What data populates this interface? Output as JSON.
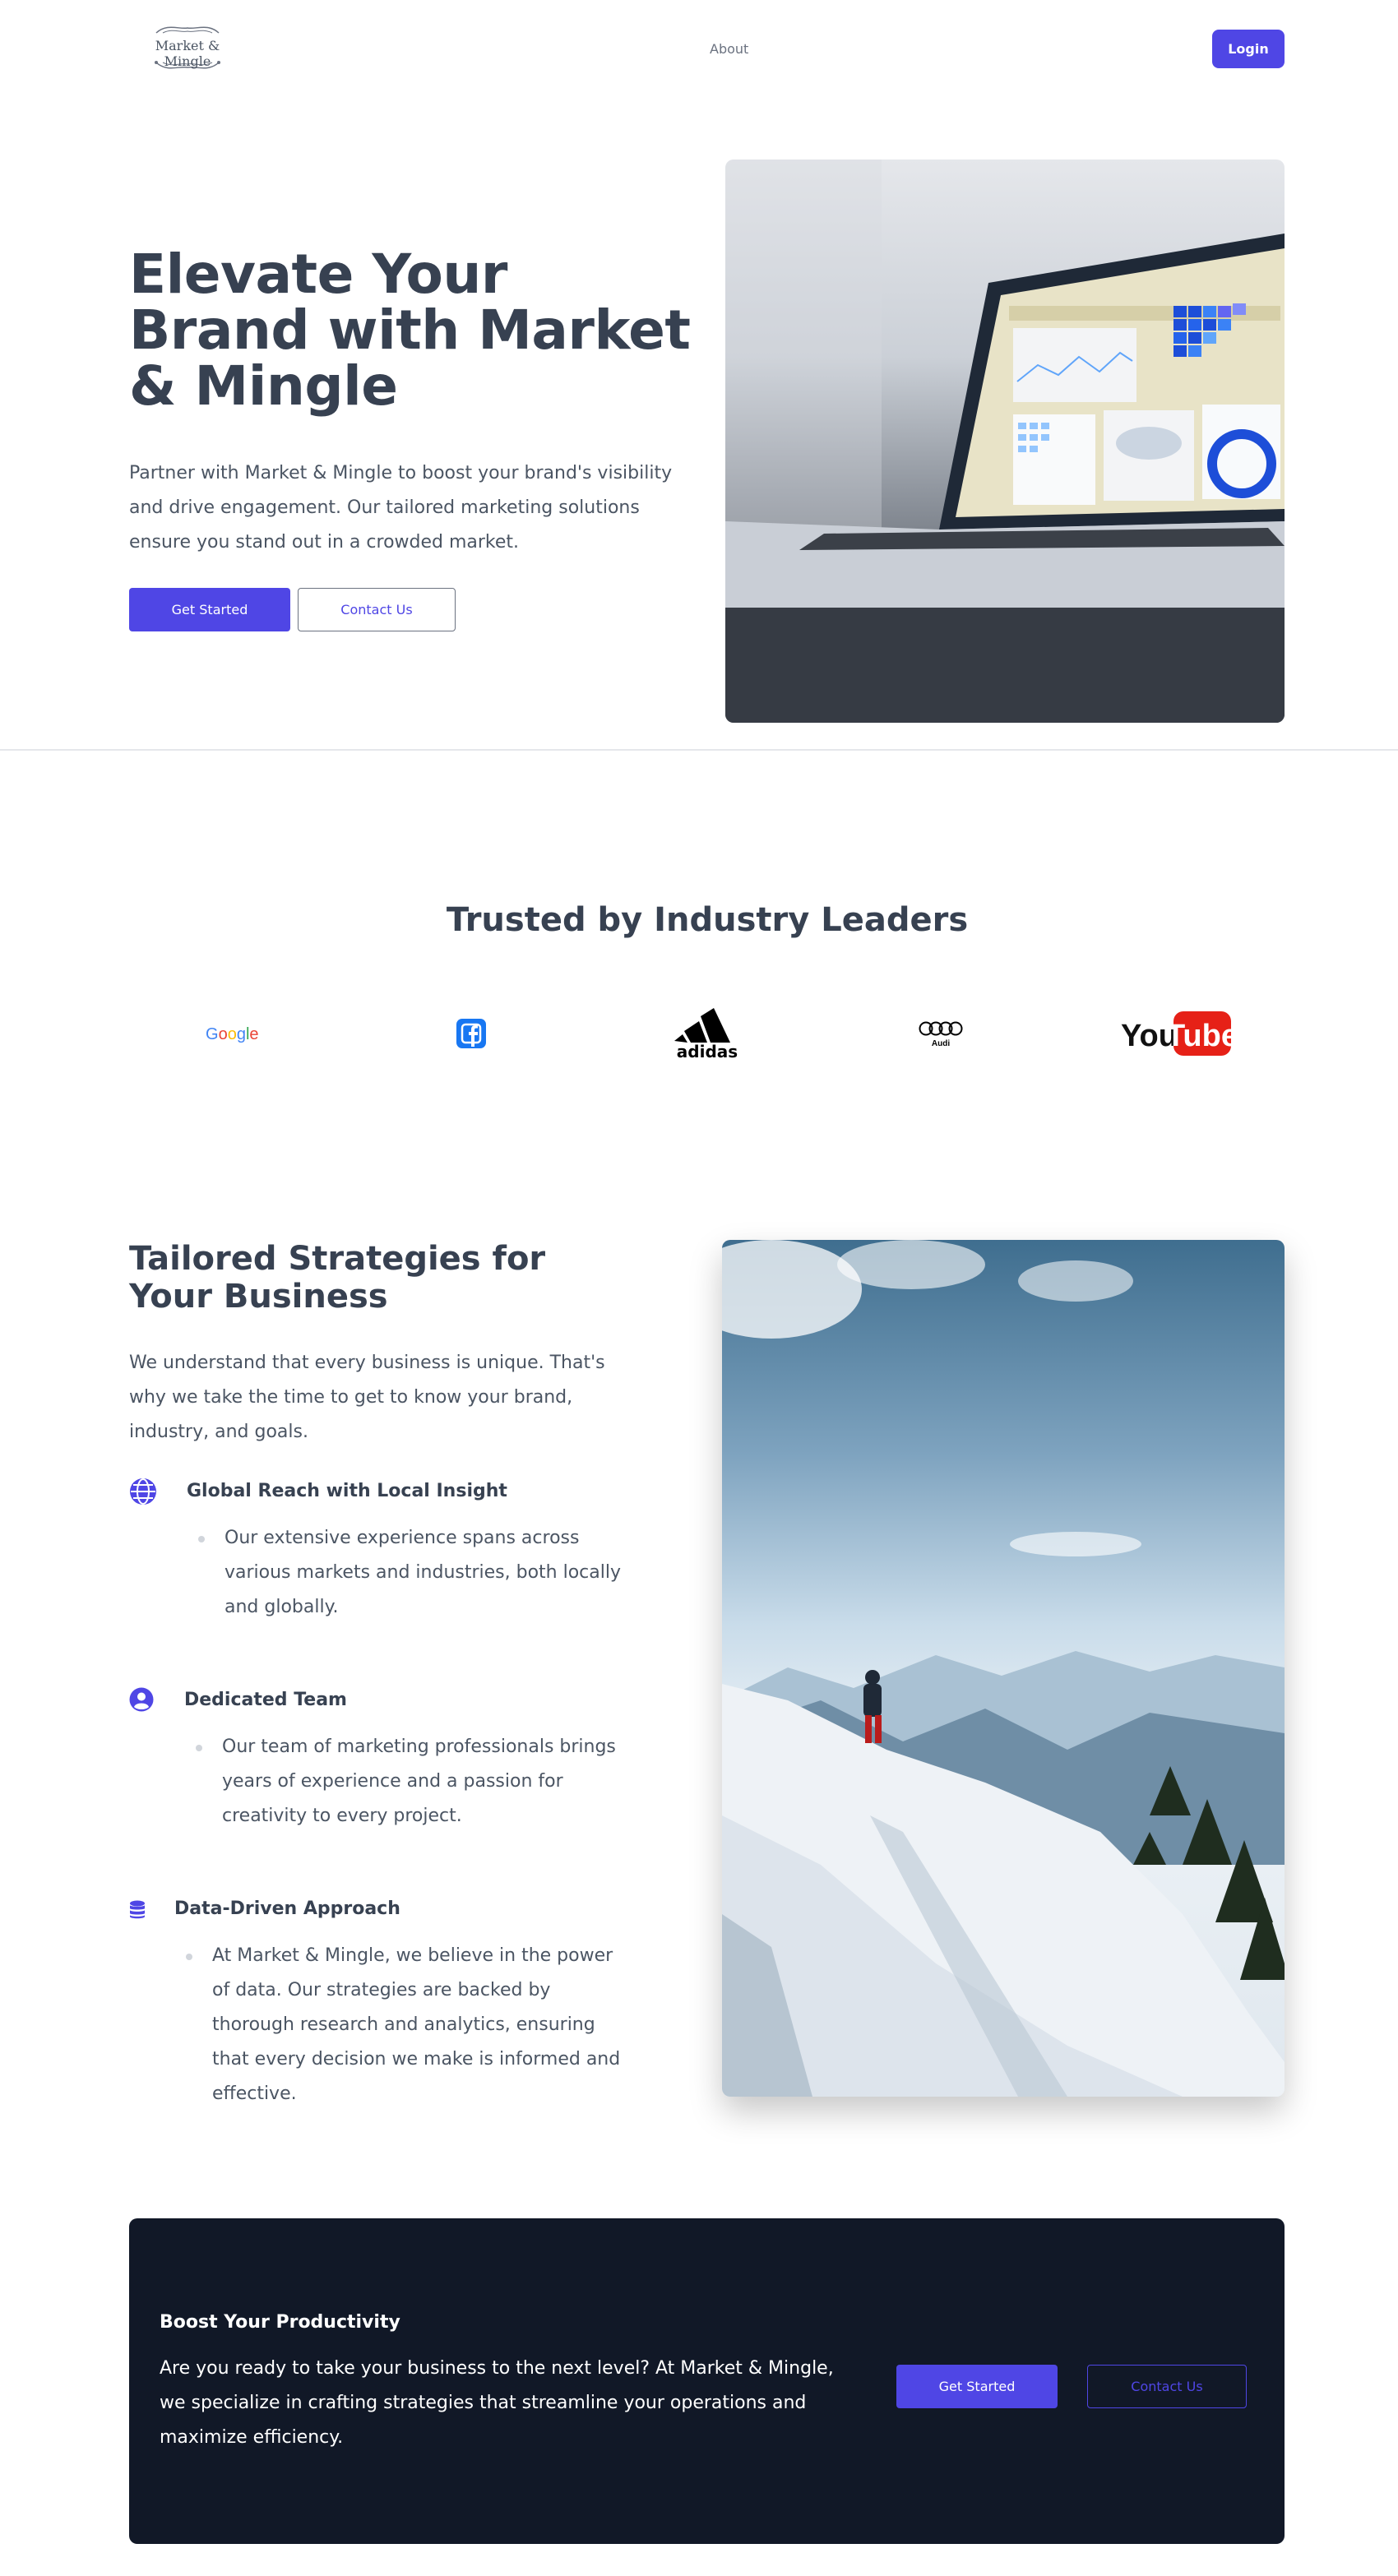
{
  "header": {
    "logo_text": "Market & Mingle",
    "nav_about": "About",
    "login_label": "Login"
  },
  "hero": {
    "title": "Elevate Your Brand with Market & Mingle",
    "description": "Partner with Market & Mingle to boost your brand's visibility and drive engagement. Our tailored marketing solutions ensure you stand out in a crowded market.",
    "primary_label": "Get Started",
    "secondary_label": "Contact Us",
    "image_icon": "laptop-dashboard-photo"
  },
  "trusted": {
    "title": "Trusted by Industry Leaders",
    "brands": [
      {
        "name": "Google",
        "icon": "google-logo"
      },
      {
        "name": "Facebook",
        "icon": "facebook-icon"
      },
      {
        "name": "adidas",
        "icon": "adidas-logo"
      },
      {
        "name": "Audi",
        "icon": "audi-logo"
      },
      {
        "name": "YouTube",
        "icon": "youtube-logo"
      }
    ]
  },
  "strategies": {
    "title": "Tailored Strategies for Your Business",
    "description": "We understand that every business is unique. That's why we take the time to get to know your brand, industry, and goals.",
    "features": [
      {
        "title": "Global Reach with Local Insight",
        "text": "Our extensive experience spans across various markets and industries, both locally and globally.",
        "icon": "globe-icon"
      },
      {
        "title": "Dedicated Team",
        "text": "Our team of marketing professionals brings years of experience and a passion for creativity to every project.",
        "icon": "user-circle-icon"
      },
      {
        "title": "Data-Driven Approach",
        "text": "At Market & Mingle, we believe in the power of data. Our strategies are backed by thorough research and analytics, ensuring that every decision we make is informed and effective.",
        "icon": "database-icon"
      }
    ],
    "image_icon": "mountain-hiker-photo"
  },
  "cta": {
    "title": "Boost Your Productivity",
    "description": "Are you ready to take your business to the next level? At Market & Mingle, we specialize in crafting strategies that streamline your operations and maximize efficiency.",
    "primary_label": "Get Started",
    "secondary_label": "Contact Us"
  },
  "colors": {
    "accent": "#4f46e5",
    "heading": "#374151",
    "body_text": "#4b5563",
    "cta_bg": "#111827"
  }
}
